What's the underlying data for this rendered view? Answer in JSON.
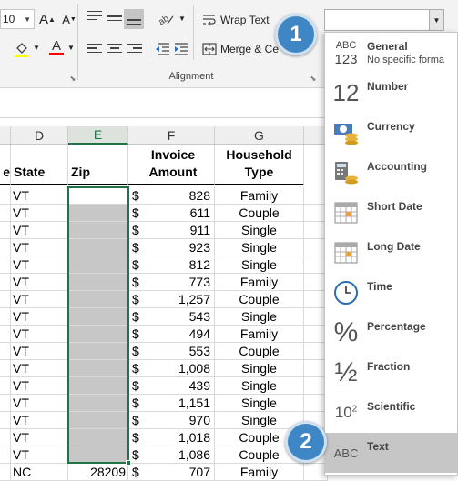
{
  "ribbon": {
    "font_size": "10",
    "wrap_text_label": "Wrap Text",
    "merge_label": "Merge & Ce",
    "alignment_group_label": "Alignment",
    "number_format_value": ""
  },
  "badges": {
    "step1": "1",
    "step2": "2"
  },
  "columns": [
    "D",
    "E",
    "F",
    "G"
  ],
  "headers": {
    "partial": "e",
    "state": "State",
    "zip": "Zip",
    "invoice": "Invoice Amount",
    "household": "Household Type"
  },
  "rows": [
    {
      "state": "VT",
      "zip": "",
      "dollar": "$",
      "amount": "828",
      "type": "Family"
    },
    {
      "state": "VT",
      "zip": "",
      "dollar": "$",
      "amount": "611",
      "type": "Couple"
    },
    {
      "state": "VT",
      "zip": "",
      "dollar": "$",
      "amount": "911",
      "type": "Single"
    },
    {
      "state": "VT",
      "zip": "",
      "dollar": "$",
      "amount": "923",
      "type": "Single"
    },
    {
      "state": "VT",
      "zip": "",
      "dollar": "$",
      "amount": "812",
      "type": "Single"
    },
    {
      "state": "VT",
      "zip": "",
      "dollar": "$",
      "amount": "773",
      "type": "Family"
    },
    {
      "state": "VT",
      "zip": "",
      "dollar": "$",
      "amount": "1,257",
      "type": "Couple"
    },
    {
      "state": "VT",
      "zip": "",
      "dollar": "$",
      "amount": "543",
      "type": "Single"
    },
    {
      "state": "VT",
      "zip": "",
      "dollar": "$",
      "amount": "494",
      "type": "Family"
    },
    {
      "state": "VT",
      "zip": "",
      "dollar": "$",
      "amount": "553",
      "type": "Couple"
    },
    {
      "state": "VT",
      "zip": "",
      "dollar": "$",
      "amount": "1,008",
      "type": "Single"
    },
    {
      "state": "VT",
      "zip": "",
      "dollar": "$",
      "amount": "439",
      "type": "Single"
    },
    {
      "state": "VT",
      "zip": "",
      "dollar": "$",
      "amount": "1,151",
      "type": "Single"
    },
    {
      "state": "VT",
      "zip": "",
      "dollar": "$",
      "amount": "970",
      "type": "Single"
    },
    {
      "state": "VT",
      "zip": "",
      "dollar": "$",
      "amount": "1,018",
      "type": "Couple"
    },
    {
      "state": "VT",
      "zip": "",
      "dollar": "$",
      "amount": "1,086",
      "type": "Couple"
    },
    {
      "state": "NC",
      "zip": "28209",
      "dollar": "$",
      "amount": "707",
      "type": "Family"
    }
  ],
  "formats": [
    {
      "label": "General",
      "desc": "No specific forma",
      "icon": "abc-123-icon"
    },
    {
      "label": "Number",
      "desc": "",
      "icon": "number-12-icon"
    },
    {
      "label": "Currency",
      "desc": "",
      "icon": "currency-icon"
    },
    {
      "label": "Accounting",
      "desc": "",
      "icon": "accounting-icon"
    },
    {
      "label": "Short Date",
      "desc": "",
      "icon": "calendar-icon"
    },
    {
      "label": "Long Date",
      "desc": "",
      "icon": "calendar-icon"
    },
    {
      "label": "Time",
      "desc": "",
      "icon": "clock-icon"
    },
    {
      "label": "Percentage",
      "desc": "",
      "icon": "percent-icon"
    },
    {
      "label": "Fraction",
      "desc": "",
      "icon": "fraction-icon"
    },
    {
      "label": "Scientific",
      "desc": "",
      "icon": "scientific-icon"
    },
    {
      "label": "Text",
      "desc": "",
      "icon": "abc-icon"
    }
  ],
  "format_icon_text": {
    "general_top": "ABC",
    "general_bottom": "123",
    "number": "12",
    "percent": "%",
    "fraction": "½",
    "scientific": "10",
    "scientific_exp": "2",
    "text": "ABC"
  },
  "colors": {
    "accent_green": "#217346",
    "badge_blue": "#3f86c4",
    "highlight_yellow": "#ffff00",
    "font_red": "#ff0000",
    "zip_fill": "#c7c7c7"
  }
}
